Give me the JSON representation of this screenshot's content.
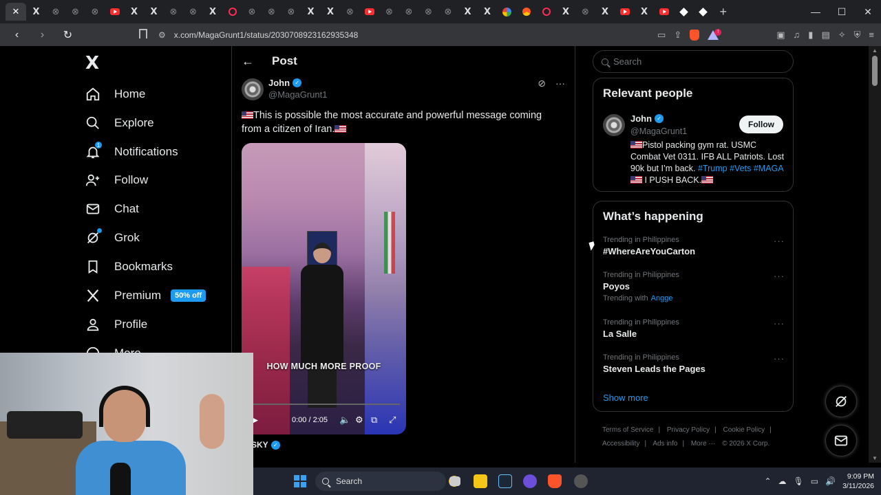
{
  "browser": {
    "url": "x.com/MagaGrunt1/status/2030708923162935348",
    "active_tab_icon": "close-icon"
  },
  "nav": {
    "logo": "X",
    "items": [
      {
        "key": "home",
        "label": "Home",
        "icon": "home-icon"
      },
      {
        "key": "explore",
        "label": "Explore",
        "icon": "search-icon"
      },
      {
        "key": "notifications",
        "label": "Notifications",
        "icon": "bell-icon",
        "badge": "1"
      },
      {
        "key": "follow",
        "label": "Follow",
        "icon": "add-person-icon"
      },
      {
        "key": "chat",
        "label": "Chat",
        "icon": "envelope-icon"
      },
      {
        "key": "grok",
        "label": "Grok",
        "icon": "grok-icon"
      },
      {
        "key": "bookmarks",
        "label": "Bookmarks",
        "icon": "bookmark-icon"
      },
      {
        "key": "premium",
        "label": "Premium",
        "icon": "x-icon",
        "promo": "50% off"
      },
      {
        "key": "profile",
        "label": "Profile",
        "icon": "person-icon"
      },
      {
        "key": "more",
        "label": "More",
        "icon": "more-circle-icon"
      }
    ]
  },
  "post": {
    "header_title": "Post",
    "author_name": "John",
    "author_handle": "@MagaGrunt1",
    "text": "This is possible the most accurate and powerful message coming from a citizen of Iran.",
    "video": {
      "caption": "HOW MUCH MORE PROOF",
      "time": "0:00 / 2:05",
      "progress": 0
    },
    "next_author": "SKY"
  },
  "sidebar": {
    "search_placeholder": "Search",
    "relevant": {
      "title": "Relevant people",
      "name": "John",
      "handle": "@MagaGrunt1",
      "follow_label": "Follow",
      "bio_1": "Pistol packing gym rat. USMC Combat Vet 0311. IFB ALL Patriots. Lost 90k but I’m back.",
      "bio_tag_1": "#Trump",
      "bio_tag_2": "#Vets",
      "bio_tag_3": "#MAGA",
      "bio_2": "I PUSH BACK."
    },
    "happening": {
      "title": "What’s happening",
      "trends": [
        {
          "context": "Trending in Philippines",
          "title": "#WhereAreYouCarton"
        },
        {
          "context": "Trending in Philippines",
          "title": "Poyos",
          "with_label": "Trending with",
          "with_link": "Angge"
        },
        {
          "context": "Trending in Philippines",
          "title": "La Salle"
        },
        {
          "context": "Trending in Philippines",
          "title": "Steven Leads the Pages"
        }
      ],
      "show_more": "Show more"
    },
    "footer": {
      "terms": "Terms of Service",
      "privacy": "Privacy Policy",
      "cookie": "Cookie Policy",
      "accessibility": "Accessibility",
      "ads": "Ads info",
      "more": "More ···",
      "copyright": "© 2026 X Corp."
    }
  },
  "taskbar": {
    "search_label": "Search",
    "time": "9:09 PM",
    "date": "3/11/2026"
  },
  "colors": {
    "accent": "#1d9bf0",
    "background": "#000000",
    "text": "#e7e9ea",
    "muted": "#71767b"
  }
}
